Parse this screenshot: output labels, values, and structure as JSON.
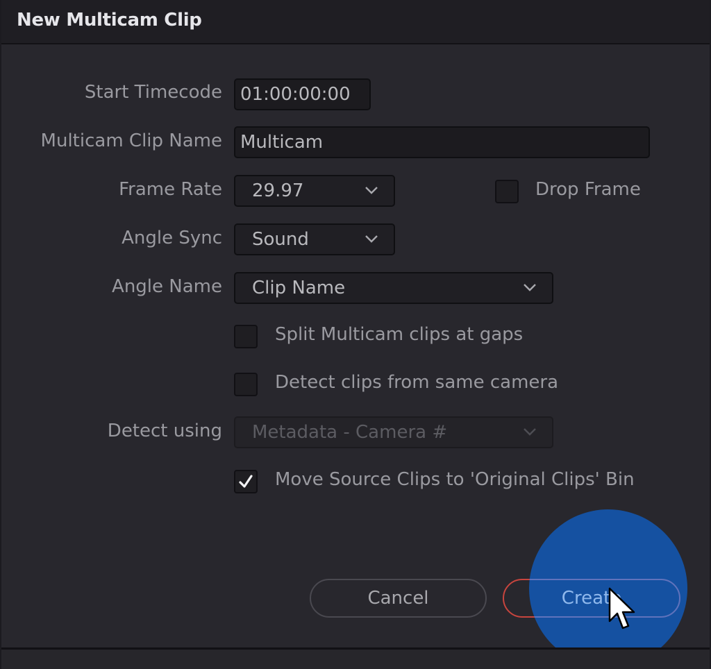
{
  "dialog": {
    "title": "New Multicam Clip"
  },
  "form": {
    "start_timecode": {
      "label": "Start Timecode",
      "value": "01:00:00:00"
    },
    "clip_name": {
      "label": "Multicam Clip Name",
      "value": "Multicam"
    },
    "frame_rate": {
      "label": "Frame Rate",
      "value": "29.97"
    },
    "drop_frame": {
      "label": "Drop Frame",
      "checked": false
    },
    "angle_sync": {
      "label": "Angle Sync",
      "value": "Sound"
    },
    "angle_name": {
      "label": "Angle Name",
      "value": "Clip Name"
    },
    "split_at_gaps": {
      "label": "Split Multicam clips at gaps",
      "checked": false
    },
    "detect_same_camera": {
      "label": "Detect clips from same camera",
      "checked": false
    },
    "detect_using": {
      "label": "Detect using",
      "value": "Metadata - Camera #",
      "disabled": true
    },
    "move_source_clips": {
      "label": "Move Source Clips to 'Original Clips' Bin",
      "checked": true
    }
  },
  "buttons": {
    "cancel": "Cancel",
    "create": "Create"
  },
  "icons": {
    "dropdown": "chevron-down-icon",
    "check": "checkmark-icon",
    "cursor": "mouse-pointer-icon"
  },
  "colors": {
    "background": "#28272d",
    "titlebar": "#1f1e23",
    "primary_button_border": "#c8453e",
    "primary_button_text": "#8fb8ec",
    "click_highlight": "#1455aa"
  }
}
